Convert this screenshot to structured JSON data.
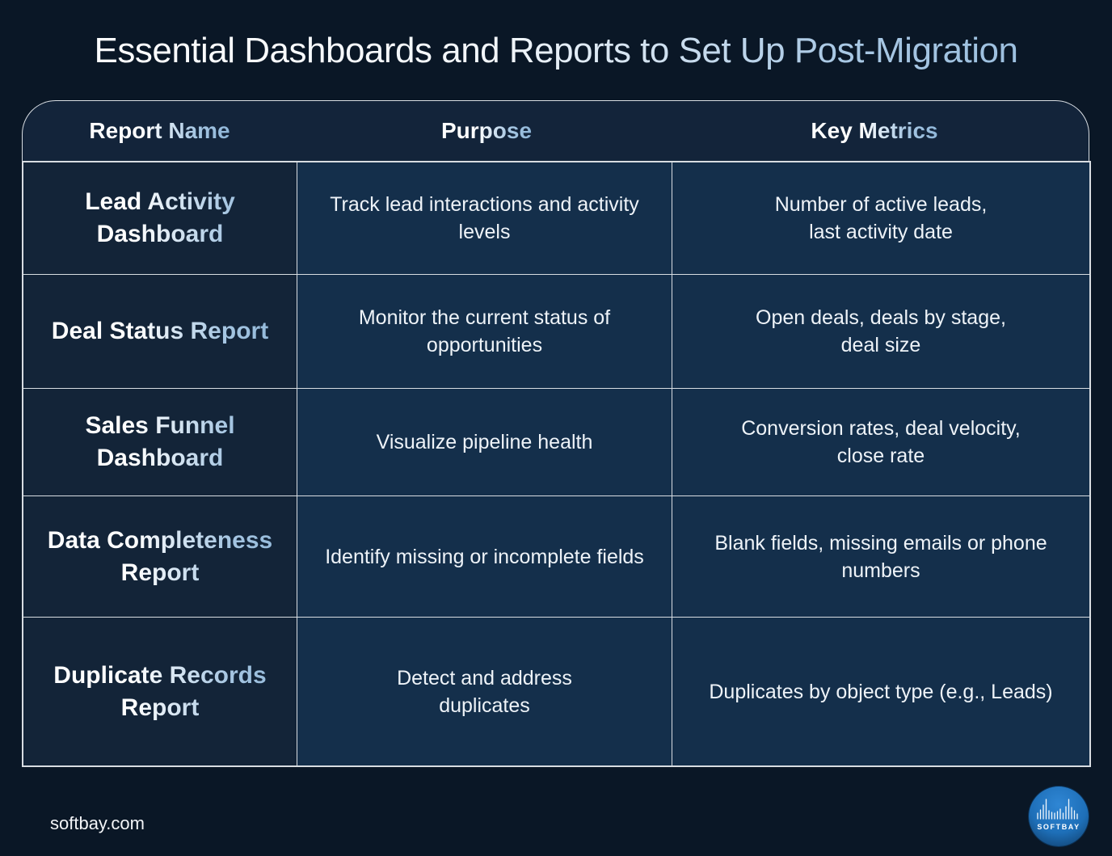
{
  "title": "Essential Dashboards and Reports to Set Up Post-Migration",
  "table": {
    "headers": [
      "Report Name",
      "Purpose",
      "Key Metrics"
    ],
    "rows": [
      {
        "name": "Lead Activity Dashboard",
        "purpose": "Track lead interactions and activity levels",
        "metrics": "Number of active leads, last activity date"
      },
      {
        "name": "Deal Status Report",
        "purpose": "Monitor the current status of opportunities",
        "metrics": "Open deals, deals by stage, deal size"
      },
      {
        "name": "Sales Funnel Dashboard",
        "purpose": "Visualize pipeline health",
        "metrics": "Conversion rates, deal velocity, close rate"
      },
      {
        "name": "Data Completeness Report",
        "purpose": "Identify missing or incomplete fields",
        "metrics": "Blank fields, missing emails or phone numbers"
      },
      {
        "name": "Duplicate Records Report",
        "purpose": "Detect and address duplicates",
        "metrics": "Duplicates by object type (e.g., Leads)"
      }
    ]
  },
  "footer": {
    "url": "softbay.com",
    "logo_text": "SOFTBAY",
    "logo_icon": "soundwave-icon"
  },
  "colors": {
    "background": "#0a1726",
    "header_bg": "#13243a",
    "name_col_bg": "#132438",
    "data_col_bg": "#142f4b",
    "accent_text": "#96bbdc",
    "border": "#d8dde2",
    "logo_blue": "#1e6fb8"
  }
}
